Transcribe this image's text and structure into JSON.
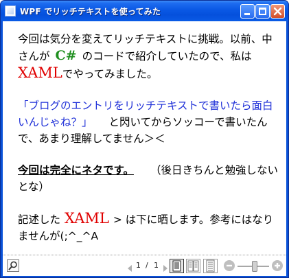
{
  "window": {
    "title": "WPF でリッチテキストを使ってみた"
  },
  "content": {
    "p1": {
      "a": "今回は気分を変えてリッチテキストに挑戦。以前、中さんが",
      "csharp": "C#",
      "b": "のコードで紹介していたので、私は",
      "xaml": "XAML",
      "c": "でやってみました。"
    },
    "p2": {
      "blue": "「ブログのエントリをリッチテキストで書いたら面白いんじゃね？」",
      "rest": "と閃いてからソッコーで書いたんで、あまり理解してません＞＜"
    },
    "p3": {
      "bold": "今回は完全にネタです。",
      "rest": "（後日きちんと勉強しないとな）"
    },
    "p4": {
      "a": "記述した",
      "xaml": "XAML",
      "b": "> は下に晒します。参考にはなりませんが(;^_^A"
    }
  },
  "toolbar": {
    "page_current": "1",
    "page_sep": "/",
    "page_total": "1",
    "zoom_level": 0.55
  },
  "icons": {
    "search": "search-icon",
    "prev": "previous-page-icon",
    "next": "next-page-icon",
    "single_page": "single-page-view-icon",
    "two_page": "two-page-view-icon",
    "scroll": "scroll-view-icon",
    "zoom_out": "zoom-out-icon",
    "zoom_in": "zoom-in-icon"
  },
  "colors": {
    "title_bar": "#0a58e4",
    "csharp": "#1e8f1e",
    "xaml": "#e00000",
    "link_blue": "#1f30d8"
  }
}
